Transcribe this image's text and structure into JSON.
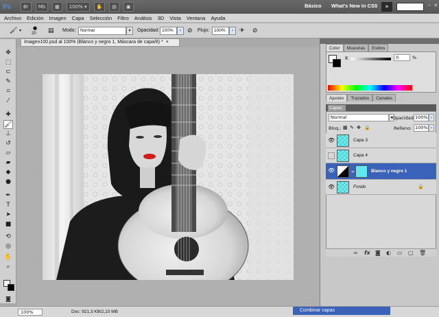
{
  "app": {
    "logo": "Ps",
    "zoom": "100%",
    "workspace_basic": "Básico",
    "workspace_new": "What's New in CS5",
    "more": "»"
  },
  "menu": [
    "Archivo",
    "Edición",
    "Imagen",
    "Capa",
    "Selección",
    "Filtro",
    "Análisis",
    "3D",
    "Vista",
    "Ventana",
    "Ayuda"
  ],
  "options": {
    "brush_size": "20",
    "mode_label": "Modo:",
    "mode_value": "Normal",
    "opacity_label": "Opacidad:",
    "opacity_value": "100%",
    "flow_label": "Flujo:",
    "flow_value": "100%"
  },
  "document": {
    "tab_title": "Imagen100.psd al 100% (Blanco y negro 1, Máscara de capa/8) *",
    "close": "×"
  },
  "status": {
    "zoom": "100%",
    "doc_info": "Doc: 921,3 KB/2,10 MB",
    "message": "Combinar capas"
  },
  "color_panel": {
    "tabs": [
      "Color",
      "Muestras",
      "Estilos"
    ],
    "k_label": "K",
    "k_value": "0",
    "percent": "%"
  },
  "adjust_panel": {
    "tabs": [
      "Ajustes",
      "Trazados",
      "Canales"
    ]
  },
  "layers_panel": {
    "title": "Capas",
    "blend_mode": "Normal",
    "opacity_label": "Opacidad:",
    "opacity_value": "100%",
    "lock_label": "Bloq.:",
    "fill_label": "Relleno:",
    "fill_value": "100%",
    "layers": [
      {
        "name": "Capa 3",
        "visible": true,
        "selected": false
      },
      {
        "name": "Capa 4",
        "visible": false,
        "selected": false
      },
      {
        "name": "Blanco y negro 1",
        "visible": true,
        "selected": true
      },
      {
        "name": "Fondo",
        "visible": true,
        "selected": false
      }
    ]
  },
  "colors": {
    "accent": "#3a62b8",
    "lips": "#d21a1a",
    "teal": "#4cd8d8"
  },
  "icons": [
    "brush-icon",
    "eye-icon",
    "lock-icon",
    "link-icon",
    "fx-icon",
    "trash-icon",
    "new-layer-icon"
  ]
}
